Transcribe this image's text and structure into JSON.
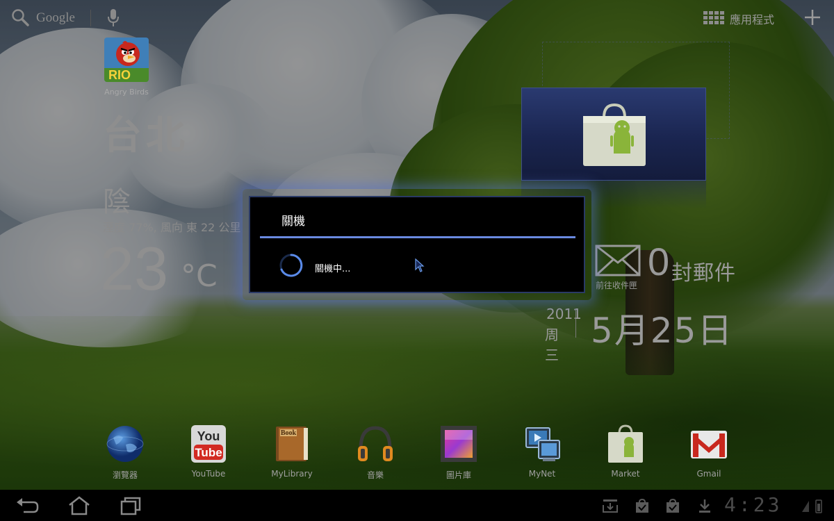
{
  "topbar": {
    "search_label": "Google",
    "apps_label": "應用程式",
    "icons": [
      "search-icon",
      "mic-icon",
      "apps-grid-icon",
      "add-icon"
    ]
  },
  "shortcuts": [
    {
      "label": "Angry Birds",
      "icon": "angry-birds-icon"
    }
  ],
  "weather": {
    "city": "台北",
    "condition": "陰",
    "detail": "溼度 77%, 風向 東 22 公里",
    "temperature": "23",
    "unit": "°C"
  },
  "email": {
    "count": "0",
    "unit": "封郵件",
    "caption": "前往收件匣"
  },
  "date": {
    "year": "2011",
    "weekday": "周三",
    "main": "5月25日"
  },
  "dock": [
    {
      "label": "瀏覽器",
      "icon": "browser-icon"
    },
    {
      "label": "YouTube",
      "icon": "youtube-icon"
    },
    {
      "label": "MyLibrary",
      "icon": "mylibrary-icon"
    },
    {
      "label": "音樂",
      "icon": "music-icon"
    },
    {
      "label": "圖片庫",
      "icon": "gallery-icon"
    },
    {
      "label": "MyNet",
      "icon": "mynet-icon"
    },
    {
      "label": "Market",
      "icon": "market-icon"
    },
    {
      "label": "Gmail",
      "icon": "gmail-icon"
    }
  ],
  "dialog": {
    "title": "關機",
    "message": "關機中..."
  },
  "statusbar": {
    "clock": "4:23",
    "nav": [
      "back-icon",
      "home-icon",
      "recent-apps-icon"
    ]
  },
  "colors": {
    "dialog_accent": "#6a8ae0",
    "dialog_glow": "#5070c8",
    "youtube_red": "#d22a22",
    "gmail_red": "#c8281e"
  }
}
